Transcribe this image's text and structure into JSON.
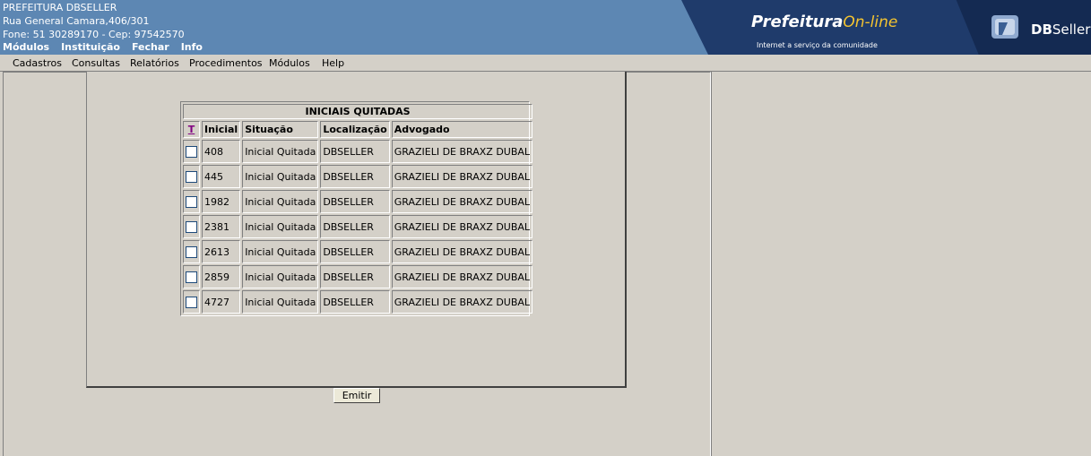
{
  "header": {
    "line1": "PREFEITURA DBSELLER",
    "line2": "Rua General Camara,406/301",
    "line3": "Fone: 51 30289170  -  Cep: 97542570",
    "nav": [
      "Módulos",
      "Instituição",
      "Fechar",
      "Info"
    ],
    "logo_part1": "Prefeitura",
    "logo_part2": "On-line",
    "logo_tagline": "Internet a serviço da comunidade",
    "brand_bold": "DB",
    "brand_rest": "Seller"
  },
  "menu": [
    "Cadastros",
    "Consultas",
    "Relatórios",
    "Procedimentos",
    "Módulos",
    "Help"
  ],
  "table": {
    "title": "INICIAIS QUITADAS",
    "toggle_all": "T",
    "headers": [
      "Inicial",
      "Situação",
      "Localização",
      "Advogado"
    ],
    "rows": [
      [
        "408",
        "Inicial Quitada",
        "DBSELLER",
        "GRAZIELI DE BRAXZ DUBAL"
      ],
      [
        "445",
        "Inicial Quitada",
        "DBSELLER",
        "GRAZIELI DE BRAXZ DUBAL"
      ],
      [
        "1982",
        "Inicial Quitada",
        "DBSELLER",
        "GRAZIELI DE BRAXZ DUBAL"
      ],
      [
        "2381",
        "Inicial Quitada",
        "DBSELLER",
        "GRAZIELI DE BRAXZ DUBAL"
      ],
      [
        "2613",
        "Inicial Quitada",
        "DBSELLER",
        "GRAZIELI DE BRAXZ DUBAL"
      ],
      [
        "2859",
        "Inicial Quitada",
        "DBSELLER",
        "GRAZIELI DE BRAXZ DUBAL"
      ],
      [
        "4727",
        "Inicial Quitada",
        "DBSELLER",
        "GRAZIELI DE BRAXZ DUBAL"
      ]
    ]
  },
  "emitir_label": "Emitir",
  "colors": {
    "header_bg": "#5d87b3",
    "banner_bg": "#1f3b6b",
    "window_bg": "#d4d0c8",
    "logo_accent": "#f4c430"
  }
}
